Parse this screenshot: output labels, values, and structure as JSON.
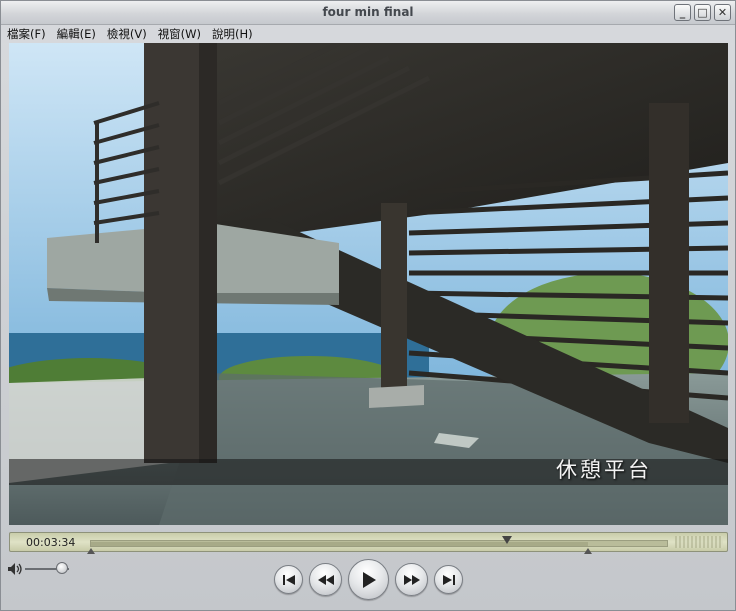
{
  "window": {
    "title": "four min final",
    "minimize_glyph": "_",
    "maximize_glyph": "□",
    "close_glyph": "✕"
  },
  "menu": {
    "items": [
      {
        "label": "檔案(F)"
      },
      {
        "label": "編輯(E)"
      },
      {
        "label": "檢視(V)"
      },
      {
        "label": "視窗(W)"
      },
      {
        "label": "說明(H)"
      }
    ]
  },
  "video": {
    "caption": "休憩平台"
  },
  "timeline": {
    "timecode": "00:03:34",
    "playhead_fraction": 0.72,
    "selection_start_fraction": 0.0,
    "selection_end_fraction": 0.86
  },
  "controls": {
    "volume_fraction": 0.85,
    "buttons": [
      "skip-back",
      "rewind",
      "play",
      "fast-forward",
      "skip-forward"
    ]
  },
  "colors": {
    "timeline_bg": "#dfe2c6",
    "window_chrome": "#d3d5d9"
  }
}
